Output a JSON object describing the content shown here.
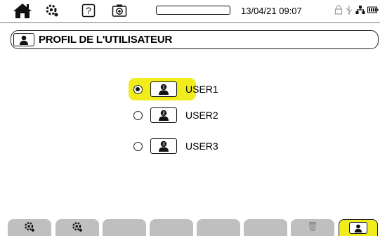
{
  "topbar": {
    "datetime": "13/04/21 09:07",
    "icons": [
      "home-icon",
      "settings-gear-icon",
      "help-icon",
      "camera-icon",
      "lock-icon",
      "usb-icon",
      "network-icon",
      "battery-icon"
    ]
  },
  "header": {
    "icon": "user-profile-icon",
    "title": "PROFIL DE L'UTILISATEUR"
  },
  "users": [
    {
      "label": "USER1",
      "number": "1",
      "selected": true
    },
    {
      "label": "USER2",
      "number": "2",
      "selected": false
    },
    {
      "label": "USER3",
      "number": "3",
      "selected": false
    }
  ],
  "softkeys": [
    "settings-gear-icon",
    "settings-gear-icon",
    "",
    "",
    "",
    "",
    "trash-icon",
    "user-profile-icon"
  ],
  "colors": {
    "highlight": "#f1ec1c",
    "softkey": "#bfbfbf"
  }
}
